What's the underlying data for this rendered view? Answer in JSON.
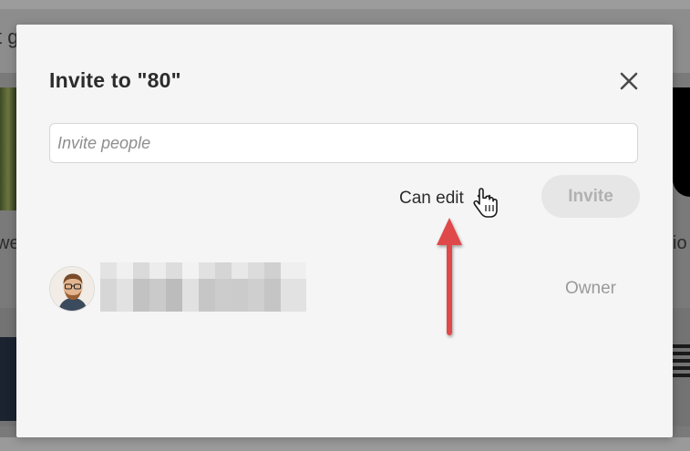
{
  "background": {
    "left_snippet_top": "t g",
    "left_snippet_mid": "we",
    "right_snippet_mid": "io"
  },
  "dialog": {
    "title": "Invite to \"80\"",
    "close_icon": "close-icon",
    "invite_input": {
      "value": "",
      "placeholder": "Invite people"
    },
    "permission": {
      "selected": "Can edit",
      "icon": "chevron-down-icon"
    },
    "invite_button_label": "Invite",
    "members": [
      {
        "avatar_icon": "user-avatar",
        "name": "",
        "role": "Owner"
      }
    ]
  },
  "annotation": {
    "arrow_color": "#e04a4a",
    "cursor_icon": "hand-pointer-icon"
  },
  "colors": {
    "dialog_bg": "#f5f5f5",
    "button_disabled_bg": "#e6e6e6",
    "button_disabled_text": "#b1b1b1",
    "accent_arrow": "#e04a4a"
  }
}
